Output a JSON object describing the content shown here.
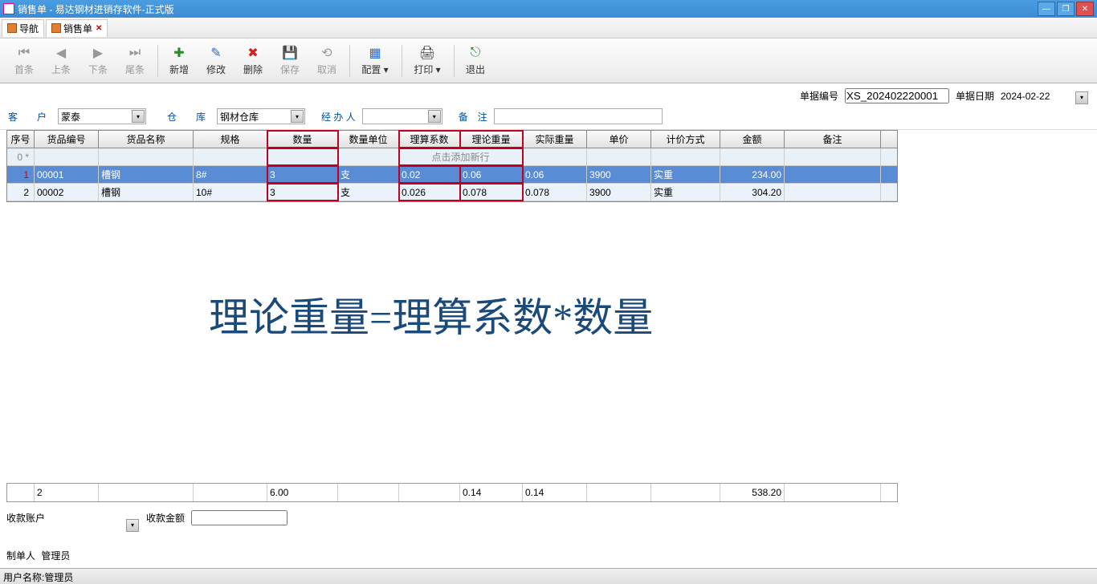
{
  "title": "销售单 - 易达钢材进销存软件-正式版",
  "tabs": [
    {
      "label": "导航"
    },
    {
      "label": "销售单",
      "closable": true
    }
  ],
  "toolbar": {
    "first": "首条",
    "prev": "上条",
    "next": "下条",
    "last": "尾条",
    "add": "新增",
    "edit": "修改",
    "del": "删除",
    "save": "保存",
    "cancel": "取消",
    "config": "配置",
    "print": "打印",
    "exit": "退出"
  },
  "docid": {
    "label": "单据编号",
    "value": "XS_202402220001",
    "datelabel": "单据日期",
    "datevalue": "2024-02-22"
  },
  "form": {
    "customer_lbl": "客　户",
    "customer": "蒙泰",
    "warehouse_lbl": "仓　库",
    "warehouse": "钢材仓库",
    "handler_lbl": "经 办 人",
    "handler": "",
    "remark_lbl": "备　注",
    "remark": ""
  },
  "columns": [
    "序号",
    "货品编号",
    "货品名称",
    "规格",
    "数量",
    "数量单位",
    "理算系数",
    "理论重量",
    "实际重量",
    "单价",
    "计价方式",
    "金额",
    "备注"
  ],
  "rows": [
    {
      "n": "0",
      "id": "",
      "name": "",
      "spec": "",
      "qty": "",
      "unit": "",
      "coef": "",
      "tw": "",
      "aw": "",
      "price": "",
      "mode": "",
      "amt": "",
      "rmk": "",
      "addnew": true,
      "addtext": "点击添加新行"
    },
    {
      "n": "1",
      "id": "00001",
      "name": "槽钢",
      "spec": "8#",
      "qty": "3",
      "unit": "支",
      "coef": "0.02",
      "tw": "0.06",
      "aw": "0.06",
      "price": "3900",
      "mode": "实重",
      "amt": "234.00",
      "rmk": "",
      "sel": true
    },
    {
      "n": "2",
      "id": "00002",
      "name": "槽钢",
      "spec": "10#",
      "qty": "3",
      "unit": "支",
      "coef": "0.026",
      "tw": "0.078",
      "aw": "0.078",
      "price": "3900",
      "mode": "实重",
      "amt": "304.20",
      "rmk": "",
      "alt": true
    }
  ],
  "sums": {
    "count": "2",
    "qty": "6.00",
    "tw": "0.14",
    "aw": "0.14",
    "amt": "538.20"
  },
  "pay": {
    "acct_lbl": "收款账户",
    "acct": "",
    "amt_lbl": "收款金额",
    "amt": ""
  },
  "maker": {
    "lbl": "制单人",
    "name": "管理员"
  },
  "status": "用户名称:管理员",
  "overlay": "理论重量=理算系数*数量"
}
